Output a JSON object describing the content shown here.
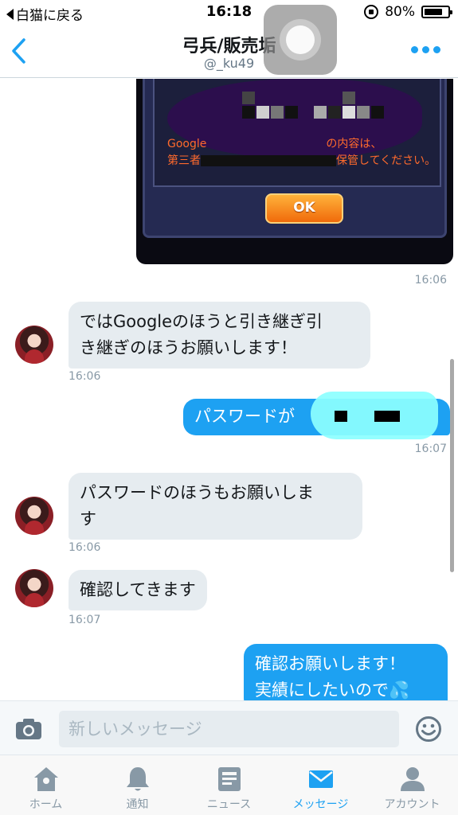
{
  "status_bar": {
    "back_label": "白猫に戻る",
    "time": "16:18",
    "battery": "80%",
    "battery_level": 0.8
  },
  "header": {
    "title": "弓兵/販売垢",
    "handle": "@_ku49"
  },
  "shared_image": {
    "warning_line1": "Google",
    "warning_line1_tail": "の内容は、",
    "warning_line2": "第三者",
    "warning_line2_tail": "保管してください。",
    "ok_label": "OK"
  },
  "messages": [
    {
      "side": "out",
      "kind": "image",
      "time": "16:06"
    },
    {
      "side": "in",
      "text_line1": "ではGoogleのほうと引き継ぎ引",
      "text_line2": "き継ぎのほうお願いします！",
      "time": "16:06"
    },
    {
      "side": "out",
      "text": "パスワードが",
      "time": "16:07"
    },
    {
      "side": "in",
      "text_line1": "パスワードのほうもお願いしま",
      "text_line2": "す",
      "time": "16:06"
    },
    {
      "side": "in",
      "text_line1": "確認してきます",
      "time": "16:07"
    },
    {
      "side": "out",
      "text_line1": "確認お願いします！",
      "text_line2": "実績にしたいので💦"
    }
  ],
  "composer": {
    "placeholder": "新しいメッセージ"
  },
  "tabs": [
    {
      "label": "ホーム",
      "icon": "home-icon",
      "active": false
    },
    {
      "label": "通知",
      "icon": "bell-icon",
      "active": false
    },
    {
      "label": "ニュース",
      "icon": "news-icon",
      "active": false
    },
    {
      "label": "メッセージ",
      "icon": "envelope-icon",
      "active": true
    },
    {
      "label": "アカウント",
      "icon": "person-icon",
      "active": false
    }
  ],
  "colors": {
    "accent": "#1da1f2",
    "bubble_in": "#e6ecf0",
    "muted": "#8899a6"
  }
}
